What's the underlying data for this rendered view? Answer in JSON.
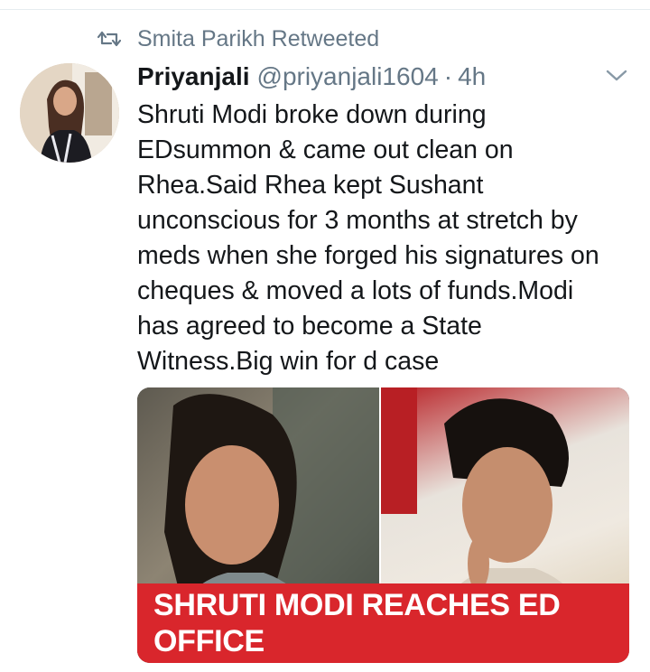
{
  "retweet": {
    "icon": "retweet-icon",
    "label": "Smita Parikh Retweeted"
  },
  "tweet": {
    "author_name": "Priyanjali",
    "author_handle": "@priyanjali1604",
    "separator": "·",
    "time": "4h",
    "menu_icon": "chevron-down-icon",
    "text": "Shruti Modi broke down during\nEDsummon & came out clean on\nRhea.Said Rhea kept Sushant\nunconscious for 3 months  at stretch by\nmeds when she forged his signatures on\ncheques & moved a lots of funds.Modi\nhas agreed to become a State\nWitness.Big win for d case"
  },
  "media": {
    "caption": "SHRUTI MODI REACHES ED OFFICE"
  },
  "colors": {
    "text_primary": "#14171a",
    "text_secondary": "#657786",
    "caption_bar": "#d9262c"
  }
}
